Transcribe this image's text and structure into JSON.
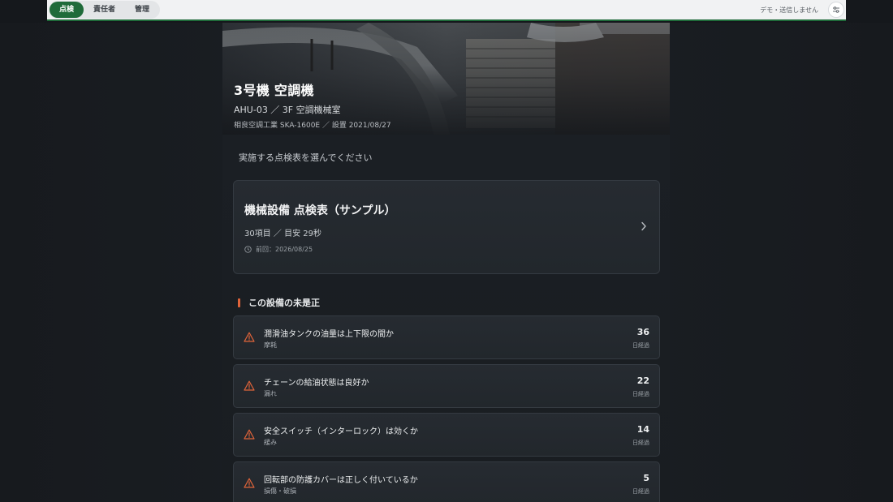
{
  "nav": {
    "tabs": [
      {
        "label": "点検",
        "active": true
      },
      {
        "label": "責任者",
        "active": false
      },
      {
        "label": "管理",
        "active": false
      }
    ],
    "demo_note": "デモ・送信しません",
    "settings_icon": "sliders-icon",
    "accent_color": "#1f6b3a"
  },
  "equipment": {
    "title": "3号機 空調機",
    "code_location": "AHU-03 ／ 3F 空調機械室",
    "maker_model_installed": "相良空調工業 SKA-1600E ／ 設置 2021/08/27"
  },
  "prompt": "実施する点検表を選んでください",
  "checklist": {
    "title": "機械設備 点検表（サンプル）",
    "info": "30項目 ／ 目安 29秒",
    "last": "前回：2026/08/25"
  },
  "issues_section": {
    "title": "この設備の未是正",
    "accent_color": "#e0643a",
    "items": [
      {
        "title": "潤滑油タンクの油量は上下限の間か",
        "tag": "摩耗",
        "days": "36",
        "unit": "日経過"
      },
      {
        "title": "チェーンの給油状態は良好か",
        "tag": "漏れ",
        "days": "22",
        "unit": "日経過"
      },
      {
        "title": "安全スイッチ（インターロック）は効くか",
        "tag": "緩み",
        "days": "14",
        "unit": "日経過"
      },
      {
        "title": "回転部の防護カバーは正しく付いているか",
        "tag": "損傷・破損",
        "days": "5",
        "unit": "日経過"
      }
    ]
  }
}
